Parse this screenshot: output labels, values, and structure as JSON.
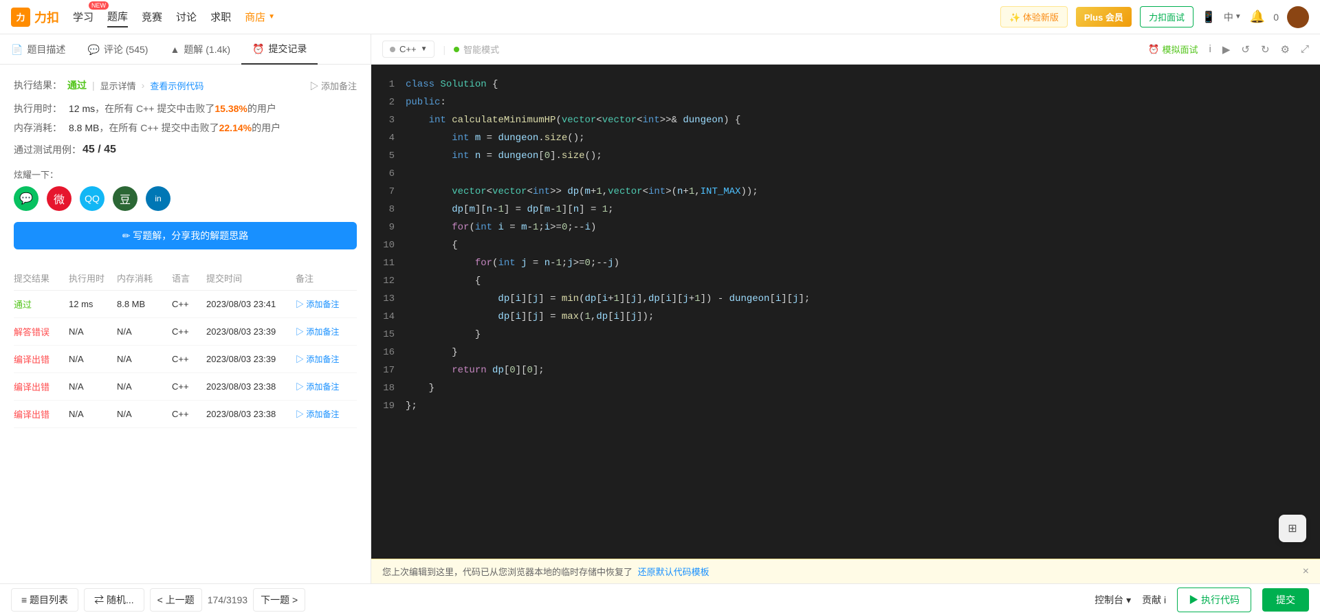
{
  "nav": {
    "logo_text": "力扣",
    "items": [
      {
        "label": "学习",
        "id": "learn",
        "has_new": true,
        "active": false
      },
      {
        "label": "题库",
        "id": "problems",
        "active": true
      },
      {
        "label": "竞赛",
        "id": "contest",
        "active": false
      },
      {
        "label": "讨论",
        "id": "discuss",
        "active": false
      },
      {
        "label": "求职",
        "id": "jobs",
        "active": false
      },
      {
        "label": "商店",
        "id": "shop",
        "active": false,
        "highlight": true
      }
    ],
    "right": {
      "experience_btn": "✨ 体验新版",
      "plus_btn": "Plus 会员",
      "interview_btn": "力扣面试",
      "notification_count": "0",
      "phone_icon": "📱",
      "lang": "中"
    }
  },
  "tabs": {
    "left": [
      {
        "label": "题目描述",
        "id": "description",
        "icon": "📄"
      },
      {
        "label": "评论 (545)",
        "id": "comments",
        "icon": "💬"
      },
      {
        "label": "题解 (1.4k)",
        "id": "solutions",
        "icon": "▲"
      },
      {
        "label": "提交记录",
        "id": "submissions",
        "icon": "⏰",
        "active": true
      }
    ],
    "right": {
      "lang": "C++",
      "mode": "智能模式",
      "mock_btn": "模拟面试",
      "info_icon": "i",
      "run_icon": "▶",
      "undo_icon": "↺",
      "redo_icon": "↻",
      "settings_icon": "⚙",
      "expand_icon": "⤢"
    }
  },
  "left_panel": {
    "result": {
      "label": "执行结果：",
      "status": "通过",
      "detail_link": "显示详情",
      "example_link": "查看示例代码",
      "add_note": "▷ 添加备注"
    },
    "metrics": [
      {
        "label": "执行用时：",
        "value": "12 ms",
        "desc_pre": "，在所有 C++ 提交中击败了",
        "highlight": "15.38%",
        "desc_post": "  的用户"
      },
      {
        "label": "内存消耗：",
        "value": "8.8 MB",
        "desc_pre": "，在所有 C++ 提交中击败了",
        "highlight": "22.14%",
        "desc_post": "  的用户"
      }
    ],
    "test_cases": {
      "label": "通过测试用例：",
      "value": "45 / 45"
    },
    "share": {
      "label": "炫耀一下：",
      "icons": [
        "微信",
        "微博",
        "QQ",
        "豆瓣",
        "领英"
      ]
    },
    "write_btn": "✏ 写题解，分享我的解题思路",
    "table": {
      "headers": [
        "提交结果",
        "执行用时",
        "内存消耗",
        "语言",
        "提交时间",
        "备注"
      ],
      "rows": [
        {
          "status": "通过",
          "status_type": "pass",
          "time": "12 ms",
          "memory": "8.8 MB",
          "lang": "C++",
          "submit_time": "2023/08/03 23:41",
          "note": "▷ 添加备注"
        },
        {
          "status": "解答错误",
          "status_type": "error",
          "time": "N/A",
          "memory": "N/A",
          "lang": "C++",
          "submit_time": "2023/08/03 23:39",
          "note": "▷ 添加备注"
        },
        {
          "status": "编译出错",
          "status_type": "compile",
          "time": "N/A",
          "memory": "N/A",
          "lang": "C++",
          "submit_time": "2023/08/03 23:39",
          "note": "▷ 添加备注"
        },
        {
          "status": "编译出错",
          "status_type": "compile",
          "time": "N/A",
          "memory": "N/A",
          "lang": "C++",
          "submit_time": "2023/08/03 23:38",
          "note": "▷ 添加备注"
        },
        {
          "status": "编译出错",
          "status_type": "compile",
          "time": "N/A",
          "memory": "N/A",
          "lang": "C++",
          "submit_time": "2023/08/03 23:38",
          "note": "▷ 添加备注"
        }
      ]
    }
  },
  "code_editor": {
    "lines": [
      {
        "num": 1,
        "content": "class Solution {"
      },
      {
        "num": 2,
        "content": "public:"
      },
      {
        "num": 3,
        "content": "    int calculateMinimumHP(vector<vector<int>>& dungeon) {"
      },
      {
        "num": 4,
        "content": "        int m = dungeon.size();"
      },
      {
        "num": 5,
        "content": "        int n = dungeon[0].size();"
      },
      {
        "num": 6,
        "content": ""
      },
      {
        "num": 7,
        "content": "        vector<vector<int>> dp(m+1,vector<int>(n+1,INT_MAX));"
      },
      {
        "num": 8,
        "content": "        dp[m][n-1] = dp[m-1][n] = 1;"
      },
      {
        "num": 9,
        "content": "        for(int i = m-1;i>=0;--i)"
      },
      {
        "num": 10,
        "content": "        {"
      },
      {
        "num": 11,
        "content": "            for(int j = n-1;j>=0;--j)"
      },
      {
        "num": 12,
        "content": "            {"
      },
      {
        "num": 13,
        "content": "                dp[i][j] = min(dp[i+1][j],dp[i][j+1]) - dungeon[i][j];"
      },
      {
        "num": 14,
        "content": "                dp[i][j] = max(1,dp[i][j]);"
      },
      {
        "num": 15,
        "content": "            }"
      },
      {
        "num": 16,
        "content": "        }"
      },
      {
        "num": 17,
        "content": "        return dp[0][0];"
      },
      {
        "num": 18,
        "content": "    }"
      },
      {
        "num": 19,
        "content": "};"
      }
    ]
  },
  "notification": {
    "text": "您上次编辑到这里，代码已从您浏览器本地的临时存储中恢复了",
    "link_text": "还原默认代码模板",
    "close": "×"
  },
  "bottom": {
    "list_btn": "≡ 题目列表",
    "random_btn": "⇄ 随机...",
    "prev_btn": "< 上一题",
    "page_info": "174/3193",
    "next_btn": "下一题 >",
    "console_btn": "控制台 ▾",
    "contribute_btn": "贡献 i",
    "run_btn": "▶ 执行代码",
    "submit_btn": "提交"
  }
}
